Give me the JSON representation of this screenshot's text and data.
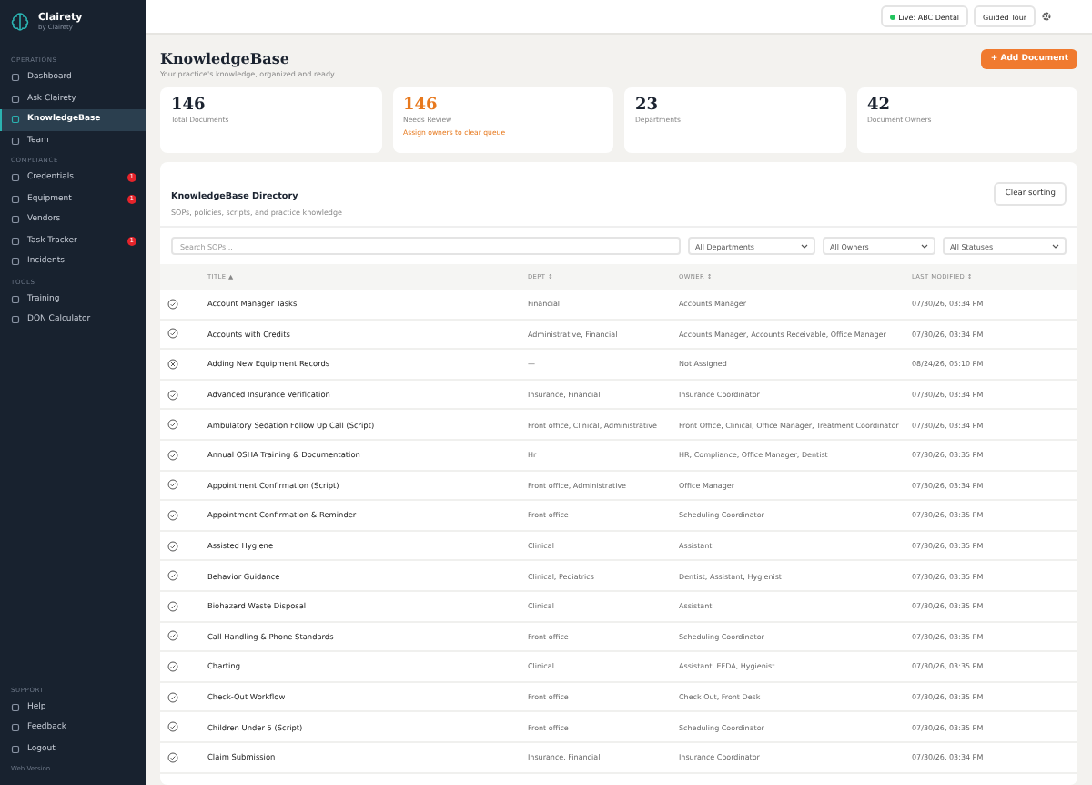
{
  "brand": {
    "name": "Clairety",
    "tagline": "by Clairety"
  },
  "sidebar": {
    "sections": [
      {
        "heading": "OPERATIONS",
        "items": [
          {
            "label": "Dashboard",
            "selected": false
          },
          {
            "label": "Ask Clairety",
            "selected": false
          },
          {
            "label": "KnowledgeBase",
            "selected": true
          },
          {
            "label": "Team",
            "selected": false
          }
        ]
      },
      {
        "heading": "COMPLIANCE",
        "items": [
          {
            "label": "Credentials",
            "selected": false,
            "badge": "1"
          },
          {
            "label": "Equipment",
            "selected": false,
            "badge": "1"
          },
          {
            "label": "Vendors",
            "selected": false
          },
          {
            "label": "Task Tracker",
            "selected": false,
            "badge": "1"
          },
          {
            "label": "Incidents",
            "selected": false
          }
        ]
      },
      {
        "heading": "TOOLS",
        "items": [
          {
            "label": "Training",
            "selected": false
          },
          {
            "label": "DON Calculator",
            "selected": false
          }
        ]
      }
    ],
    "support": {
      "heading": "SUPPORT",
      "items": [
        {
          "label": "Help",
          "selected": false
        },
        {
          "label": "Feedback",
          "selected": false
        },
        {
          "label": "Logout",
          "selected": false
        }
      ]
    },
    "version": "Web Version"
  },
  "topbar": {
    "live": "Live: ABC Dental",
    "tour": "Guided Tour"
  },
  "page": {
    "title": "KnowledgeBase",
    "subtitle": "Your practice's knowledge, organized and ready.",
    "add_button": "+ Add Document"
  },
  "stats": [
    {
      "value": "146",
      "label": "Total Documents",
      "highlight": false
    },
    {
      "value": "146",
      "label": "Needs Review",
      "highlight": true,
      "note": "Assign owners to clear queue"
    },
    {
      "value": "23",
      "label": "Departments",
      "highlight": false
    },
    {
      "value": "42",
      "label": "Document Owners",
      "highlight": false
    }
  ],
  "directory": {
    "title": "KnowledgeBase Directory",
    "subtitle": "SOPs, policies, scripts, and practice knowledge",
    "clear": "Clear sorting",
    "search": {
      "placeholder": "Search SOPs..."
    },
    "filters": [
      "All Departments",
      "All Owners",
      "All Statuses"
    ],
    "columns": [
      "TITLE ▲",
      "DEPT ↕",
      "OWNER ↕",
      "LAST MODIFIED ↕"
    ],
    "rows": [
      {
        "kind": "check",
        "title": "Account Manager Tasks",
        "dept": "Financial",
        "owner": "Accounts Manager",
        "modified": "07/30/26, 03:34 PM"
      },
      {
        "kind": "check",
        "title": "Accounts with Credits",
        "dept": "Administrative, Financial",
        "owner": "Accounts Manager, Accounts Receivable, Office Manager",
        "modified": "07/30/26, 03:34 PM"
      },
      {
        "kind": "cross",
        "title": "Adding New Equipment Records",
        "dept": "—",
        "owner": "Not Assigned",
        "modified": "08/24/26, 05:10 PM"
      },
      {
        "kind": "check",
        "title": "Advanced Insurance Verification",
        "dept": "Insurance, Financial",
        "owner": "Insurance Coordinator",
        "modified": "07/30/26, 03:34 PM"
      },
      {
        "kind": "check",
        "title": "Ambulatory Sedation Follow Up Call (Script)",
        "dept": "Front office, Clinical, Administrative",
        "owner": "Front Office, Clinical, Office Manager, Treatment Coordinator",
        "modified": "07/30/26, 03:34 PM"
      },
      {
        "kind": "check",
        "title": "Annual OSHA Training & Documentation",
        "dept": "Hr",
        "owner": "HR, Compliance, Office Manager, Dentist",
        "modified": "07/30/26, 03:35 PM"
      },
      {
        "kind": "check",
        "title": "Appointment Confirmation (Script)",
        "dept": "Front office, Administrative",
        "owner": "Office Manager",
        "modified": "07/30/26, 03:34 PM"
      },
      {
        "kind": "check",
        "title": "Appointment Confirmation & Reminder",
        "dept": "Front office",
        "owner": "Scheduling Coordinator",
        "modified": "07/30/26, 03:35 PM"
      },
      {
        "kind": "check",
        "title": "Assisted Hygiene",
        "dept": "Clinical",
        "owner": "Assistant",
        "modified": "07/30/26, 03:35 PM"
      },
      {
        "kind": "check",
        "title": "Behavior Guidance",
        "dept": "Clinical, Pediatrics",
        "owner": "Dentist, Assistant, Hygienist",
        "modified": "07/30/26, 03:35 PM"
      },
      {
        "kind": "check",
        "title": "Biohazard Waste Disposal",
        "dept": "Clinical",
        "owner": "Assistant",
        "modified": "07/30/26, 03:35 PM"
      },
      {
        "kind": "check",
        "title": "Call Handling & Phone Standards",
        "dept": "Front office",
        "owner": "Scheduling Coordinator",
        "modified": "07/30/26, 03:35 PM"
      },
      {
        "kind": "check",
        "title": "Charting",
        "dept": "Clinical",
        "owner": "Assistant, EFDA, Hygienist",
        "modified": "07/30/26, 03:35 PM"
      },
      {
        "kind": "check",
        "title": "Check-Out Workflow",
        "dept": "Front office",
        "owner": "Check Out, Front Desk",
        "modified": "07/30/26, 03:35 PM"
      },
      {
        "kind": "check",
        "title": "Children Under 5 (Script)",
        "dept": "Front office",
        "owner": "Scheduling Coordinator",
        "modified": "07/30/26, 03:35 PM"
      },
      {
        "kind": "check",
        "title": "Claim Submission",
        "dept": "Insurance, Financial",
        "owner": "Insurance Coordinator",
        "modified": "07/30/26, 03:34 PM"
      }
    ]
  }
}
